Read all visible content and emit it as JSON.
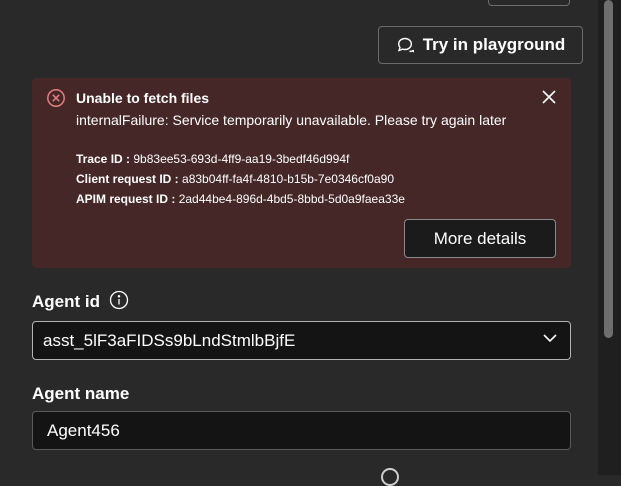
{
  "header": {
    "playground_label": "Try in playground"
  },
  "error": {
    "title": "Unable to fetch files",
    "message": "internalFailure: Service temporarily unavailable. Please try again later",
    "trace_label": "Trace ID :",
    "trace_value": "9b83ee53-693d-4ff9-aa19-3bedf46d994f",
    "client_label": "Client request ID :",
    "client_value": "a83b04ff-fa4f-4810-b15b-7e0346cf0a90",
    "apim_label": "APIM request ID :",
    "apim_value": "2ad44be4-896d-4bd5-8bbd-5d0a9faea33e",
    "more_label": "More details"
  },
  "agent_id": {
    "label": "Agent id",
    "value": "asst_5lF3aFIDSs9bLndStmlbBjfE"
  },
  "agent_name": {
    "label": "Agent name",
    "value": "Agent456"
  },
  "colors": {
    "background": "#292929",
    "error_background": "#442726",
    "error_icon": "#e37d80"
  }
}
